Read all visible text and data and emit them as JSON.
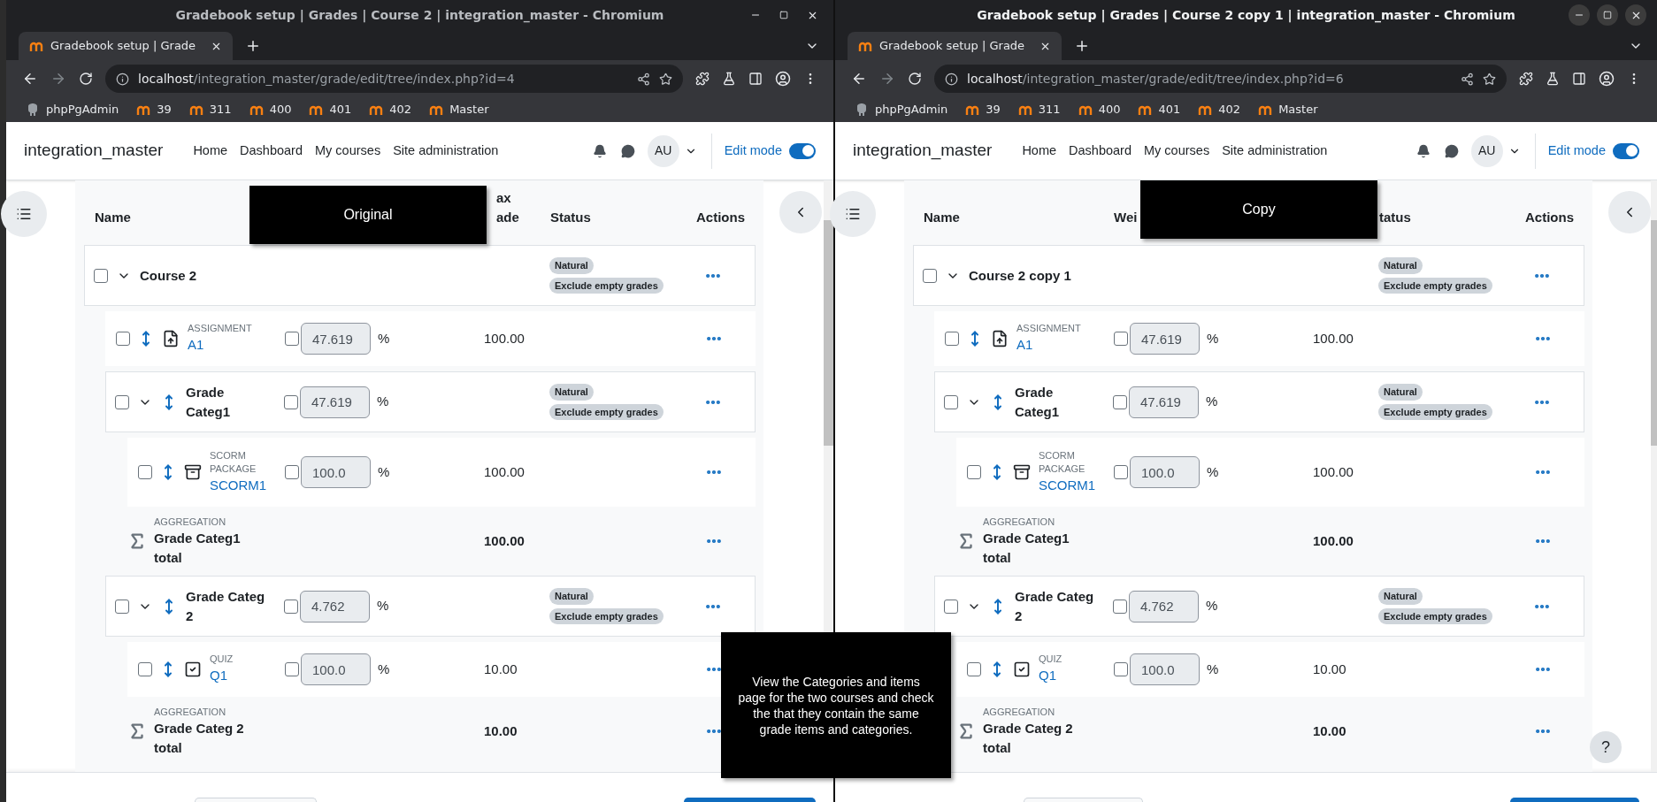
{
  "note": "View the Categories and items page for the two courses and check the that they contain the same grade items and categories.",
  "windows": [
    {
      "focused": false,
      "title": "Gradebook setup | Grades | Course 2 | integration_master - Chromium",
      "tab_title": "Gradebook setup | Grade",
      "url_host": "localhost",
      "url_path": "/integration_master/grade/edit/tree/index.php?id=4",
      "bookmarks": [
        {
          "label": "phpPgAdmin",
          "kind": "db"
        },
        {
          "label": "39",
          "kind": "lms"
        },
        {
          "label": "311",
          "kind": "lms"
        },
        {
          "label": "400",
          "kind": "lms"
        },
        {
          "label": "401",
          "kind": "lms"
        },
        {
          "label": "402",
          "kind": "lms"
        },
        {
          "label": "Master",
          "kind": "lms"
        }
      ],
      "site_name": "integration_master",
      "nav": [
        "Home",
        "Dashboard",
        "My courses",
        "Site administration"
      ],
      "avatar": "AU",
      "edit_mode": {
        "label": "Edit mode",
        "on": true
      },
      "overlay_label": "Original",
      "headers": [
        {
          "kind": "name",
          "lines": [
            "Name"
          ]
        },
        {
          "kind": "max",
          "lines": [
            "ax",
            "ade"
          ]
        },
        {
          "kind": "status",
          "lines": [
            "Status"
          ]
        },
        {
          "kind": "actions",
          "lines": [
            "Actions"
          ]
        }
      ],
      "tree": {
        "kind": "category",
        "name": "Course 2",
        "checked": false,
        "expanded": true,
        "status": [
          "Natural",
          "Exclude empty grades"
        ],
        "children": [
          {
            "kind": "assignment",
            "type": "ASSIGNMENT",
            "name": "A1",
            "checked": false,
            "weight": "47.619",
            "weight_checked": false,
            "unit": "%",
            "max": "100.00"
          },
          {
            "kind": "category",
            "name": "Grade Categ1",
            "checked": false,
            "expanded": true,
            "weight": "47.619",
            "weight_checked": false,
            "unit": "%",
            "status": [
              "Natural",
              "Exclude empty grades"
            ],
            "children": [
              {
                "kind": "scorm",
                "type": "SCORM PACKAGE",
                "name": "SCORM1",
                "checked": false,
                "weight": "100.0",
                "weight_checked": false,
                "unit": "%",
                "max": "100.00"
              },
              {
                "kind": "total",
                "type": "AGGREGATION",
                "name": "Grade Categ1 total",
                "max": "100.00"
              }
            ]
          },
          {
            "kind": "category",
            "name": "Grade Categ 2",
            "checked": false,
            "expanded": true,
            "weight": "4.762",
            "weight_checked": false,
            "unit": "%",
            "status": [
              "Natural",
              "Exclude empty grades"
            ],
            "children": [
              {
                "kind": "quiz",
                "type": "QUIZ",
                "name": "Q1",
                "checked": false,
                "weight": "100.0",
                "weight_checked": false,
                "unit": "%",
                "max": "10.00"
              },
              {
                "kind": "total",
                "type": "AGGREGATION",
                "name": "Grade Categ 2 total",
                "max": "10.00"
              }
            ]
          }
        ]
      }
    },
    {
      "focused": true,
      "title": "Gradebook setup | Grades | Course 2 copy 1 | integration_master - Chromium",
      "tab_title": "Gradebook setup | Grade",
      "url_host": "localhost",
      "url_path": "/integration_master/grade/edit/tree/index.php?id=6",
      "bookmarks": [
        {
          "label": "phpPgAdmin",
          "kind": "db"
        },
        {
          "label": "39",
          "kind": "lms"
        },
        {
          "label": "311",
          "kind": "lms"
        },
        {
          "label": "400",
          "kind": "lms"
        },
        {
          "label": "401",
          "kind": "lms"
        },
        {
          "label": "402",
          "kind": "lms"
        },
        {
          "label": "Master",
          "kind": "lms"
        }
      ],
      "site_name": "integration_master",
      "nav": [
        "Home",
        "Dashboard",
        "My courses",
        "Site administration"
      ],
      "avatar": "AU",
      "edit_mode": {
        "label": "Edit mode",
        "on": true
      },
      "overlay_label": "Copy",
      "help": "?",
      "headers": [
        {
          "kind": "name",
          "lines": [
            "Name"
          ]
        },
        {
          "kind": "weight",
          "lines": [
            "Wei"
          ]
        },
        {
          "kind": "status",
          "lines": [
            "tatus"
          ]
        },
        {
          "kind": "actions",
          "lines": [
            "Actions"
          ]
        }
      ],
      "tree": {
        "kind": "category",
        "name": "Course 2 copy 1",
        "checked": false,
        "expanded": true,
        "status": [
          "Natural",
          "Exclude empty grades"
        ],
        "children": [
          {
            "kind": "assignment",
            "type": "ASSIGNMENT",
            "name": "A1",
            "checked": false,
            "weight": "47.619",
            "weight_checked": false,
            "unit": "%",
            "max": "100.00"
          },
          {
            "kind": "category",
            "name": "Grade Categ1",
            "checked": false,
            "expanded": true,
            "weight": "47.619",
            "weight_checked": false,
            "unit": "%",
            "status": [
              "Natural",
              "Exclude empty grades"
            ],
            "children": [
              {
                "kind": "scorm",
                "type": "SCORM PACKAGE",
                "name": "SCORM1",
                "checked": false,
                "weight": "100.0",
                "weight_checked": false,
                "unit": "%",
                "max": "100.00"
              },
              {
                "kind": "total",
                "type": "AGGREGATION",
                "name": "Grade Categ1 total",
                "max": "100.00"
              }
            ]
          },
          {
            "kind": "category",
            "name": "Grade Categ 2",
            "checked": false,
            "expanded": true,
            "weight": "4.762",
            "weight_checked": false,
            "unit": "%",
            "status": [
              "Natural",
              "Exclude empty grades"
            ],
            "children": [
              {
                "kind": "quiz",
                "type": "QUIZ",
                "name": "Q1",
                "checked": false,
                "weight": "100.0",
                "weight_checked": false,
                "unit": "%",
                "max": "10.00"
              },
              {
                "kind": "total",
                "type": "AGGREGATION",
                "name": "Grade Categ 2 total",
                "max": "10.00"
              }
            ]
          }
        ]
      }
    }
  ]
}
